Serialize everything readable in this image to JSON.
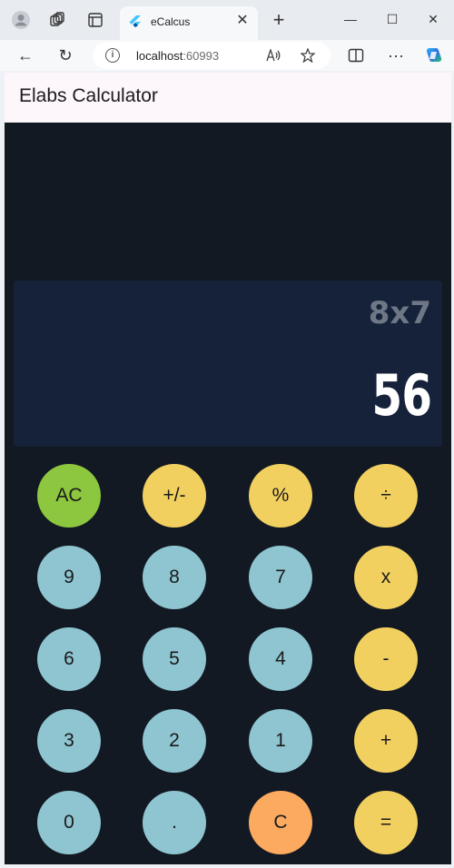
{
  "browser": {
    "tab": {
      "title": "eCalcus",
      "close": "✕"
    },
    "new_tab": "+",
    "window": {
      "minimize": "—",
      "maximize": "☐",
      "close": "✕"
    },
    "nav": {
      "back": "←",
      "refresh": "↻",
      "more": "···"
    },
    "address": {
      "host": "localhost",
      "port": ":60993"
    }
  },
  "app": {
    "title": "Elabs Calculator",
    "display": {
      "expression": "8x7",
      "result": "56"
    },
    "colors": {
      "function": "#8dc63f",
      "operator": "#f2d060",
      "digit": "#8ec5d1",
      "clear": "#fbaa60",
      "background": "#121922",
      "display": "#16223a"
    },
    "keys": [
      {
        "label": "AC",
        "kind": "function"
      },
      {
        "label": "+/-",
        "kind": "operator"
      },
      {
        "label": "%",
        "kind": "operator"
      },
      {
        "label": "÷",
        "kind": "operator"
      },
      {
        "label": "9",
        "kind": "digit"
      },
      {
        "label": "8",
        "kind": "digit"
      },
      {
        "label": "7",
        "kind": "digit"
      },
      {
        "label": "x",
        "kind": "operator"
      },
      {
        "label": "6",
        "kind": "digit"
      },
      {
        "label": "5",
        "kind": "digit"
      },
      {
        "label": "4",
        "kind": "digit"
      },
      {
        "label": "-",
        "kind": "operator"
      },
      {
        "label": "3",
        "kind": "digit"
      },
      {
        "label": "2",
        "kind": "digit"
      },
      {
        "label": "1",
        "kind": "digit"
      },
      {
        "label": "+",
        "kind": "operator"
      },
      {
        "label": "0",
        "kind": "digit"
      },
      {
        "label": ".",
        "kind": "digit"
      },
      {
        "label": "C",
        "kind": "clear"
      },
      {
        "label": "=",
        "kind": "operator"
      }
    ]
  }
}
